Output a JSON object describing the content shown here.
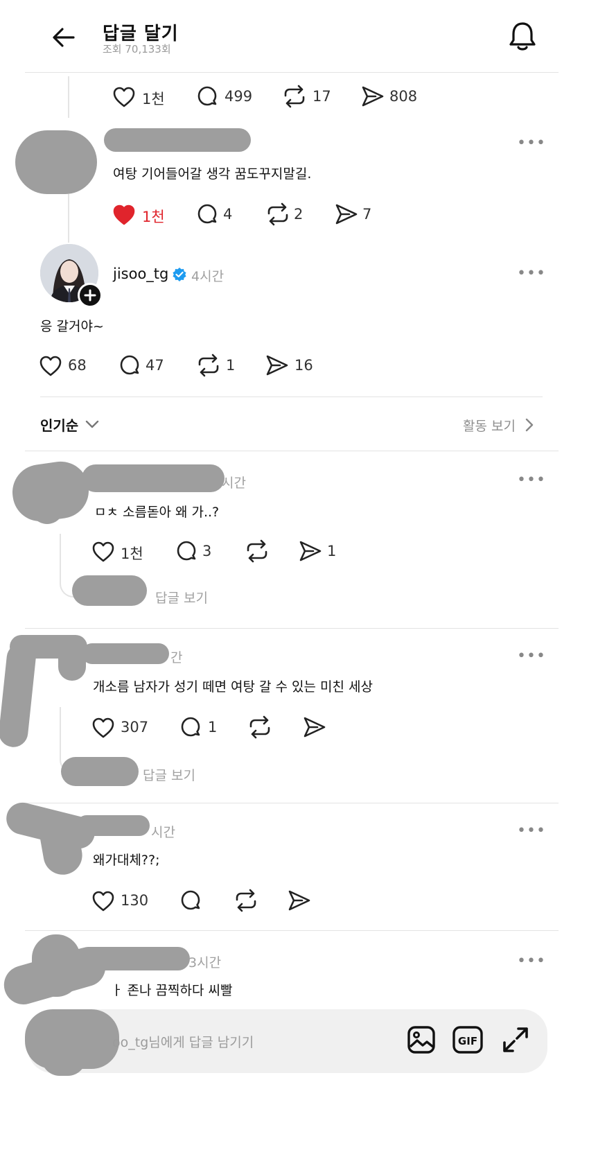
{
  "header": {
    "title": "답글 달기",
    "views": "조회 70,133회"
  },
  "top_post_stats": {
    "likes": "1천",
    "comments": "499",
    "reposts": "17",
    "shares": "808"
  },
  "comment1": {
    "text": "여탕 기어들어갈 생각 꿈도꾸지말길.",
    "likes": "1천",
    "comments": "4",
    "reposts": "2",
    "shares": "7",
    "liked": true,
    "accent_color": "#e0242c"
  },
  "reply": {
    "username": "jisoo_tg",
    "time": "4시간",
    "text": "응 갈거야~",
    "likes": "68",
    "comments": "47",
    "reposts": "1",
    "shares": "16",
    "verified_icon": "verified-badge-icon",
    "verified_color": "#1d9bf0"
  },
  "sort": {
    "label": "인기순",
    "activity_label": "활동 보기"
  },
  "replies": [
    {
      "time": "시간",
      "text": "ㅁㅊ 소름돋아 왜 가..?",
      "likes": "1천",
      "comments": "3",
      "reposts": "",
      "shares": "1",
      "view_replies": "답글 보기"
    },
    {
      "time": "간",
      "text": "개소름 남자가 성기 떼면 여탕 갈 수 있는 미친 세상",
      "likes": "307",
      "comments": "1",
      "reposts": "",
      "shares": "",
      "view_replies": "답글 보기"
    },
    {
      "time": "시간",
      "text": "왜가대체??;",
      "likes": "130",
      "comments": "",
      "reposts": "",
      "shares": ""
    },
    {
      "time": "3시간",
      "text": "ㅏ 존나 끔찍하다 씨빨"
    }
  ],
  "reply_bar": {
    "placeholder": "oo_tg님에게 답글 남기기"
  },
  "icons": [
    "back-arrow-icon",
    "bell-icon",
    "heart-icon",
    "comment-icon",
    "repost-icon",
    "share-icon",
    "more-icon",
    "chevron-down-icon",
    "chevron-right-icon",
    "image-icon",
    "gif-icon",
    "expand-icon"
  ]
}
